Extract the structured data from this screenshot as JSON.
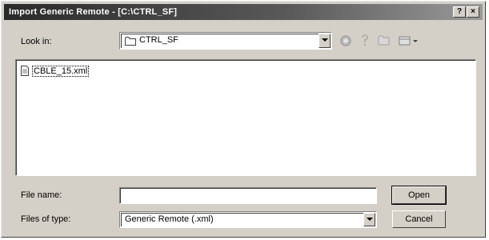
{
  "window": {
    "title": "Import Generic Remote - [C:\\CTRL_SF]",
    "help_button": "?",
    "close_button": "×"
  },
  "look_in": {
    "label": "Look in:",
    "value": "CTRL_SF",
    "icons": [
      "folder-icon",
      "back-icon",
      "up-folder-icon",
      "new-folder-icon",
      "view-menu-icon"
    ]
  },
  "file_list": {
    "items": [
      {
        "name": "CBLE_15.xml",
        "icon": "xml-file-icon"
      }
    ]
  },
  "file_name": {
    "label": "File name:",
    "value": "",
    "placeholder": ""
  },
  "files_of_type": {
    "label": "Files of type:",
    "value": "Generic Remote (.xml)"
  },
  "buttons": {
    "open": "Open",
    "cancel": "Cancel"
  }
}
